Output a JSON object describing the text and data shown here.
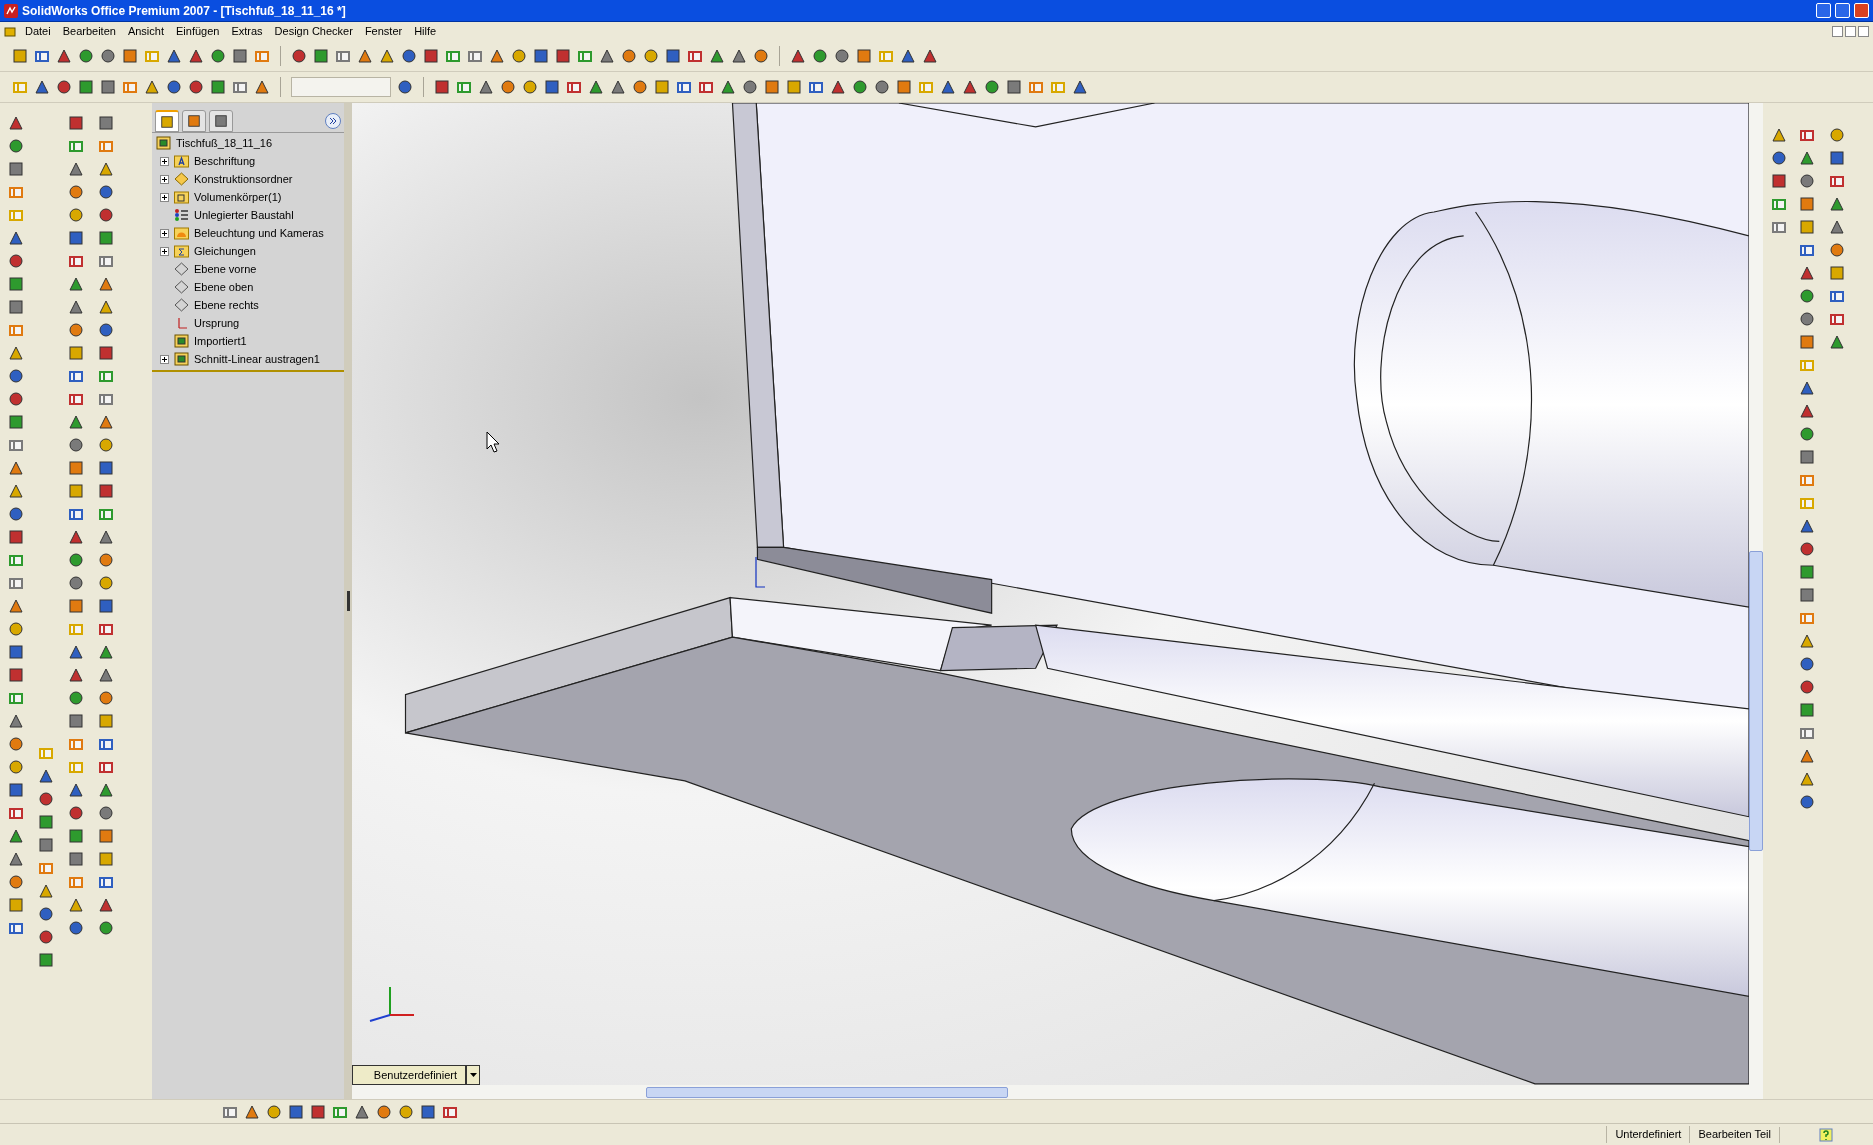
{
  "window": {
    "title": "SolidWorks Office Premium 2007 - [Tischfuß_18_11_16 *]"
  },
  "menu": [
    {
      "label": "Datei"
    },
    {
      "label": "Bearbeiten"
    },
    {
      "label": "Ansicht"
    },
    {
      "label": "Einfügen"
    },
    {
      "label": "Extras"
    },
    {
      "label": "Design Checker"
    },
    {
      "label": "Fenster"
    },
    {
      "label": "Hilfe"
    }
  ],
  "panel_tabs": [
    {
      "selected": true
    },
    {
      "selected": false
    },
    {
      "selected": false
    }
  ],
  "tree": {
    "root": "Tischfuß_18_11_16",
    "items": [
      {
        "label": "Beschriftung",
        "kind": "annotations",
        "expander": true
      },
      {
        "label": "Konstruktionsordner",
        "kind": "design",
        "expander": true
      },
      {
        "label": "Volumenkörper(1)",
        "kind": "bodies",
        "expander": true
      },
      {
        "label": "Unlegierter Baustahl",
        "kind": "material",
        "expander": false
      },
      {
        "label": "Beleuchtung und Kameras",
        "kind": "lights",
        "expander": true
      },
      {
        "label": "Gleichungen",
        "kind": "equations",
        "expander": true
      },
      {
        "label": "Ebene vorne",
        "kind": "plane",
        "expander": false
      },
      {
        "label": "Ebene oben",
        "kind": "plane",
        "expander": false
      },
      {
        "label": "Ebene rechts",
        "kind": "plane",
        "expander": false
      },
      {
        "label": "Ursprung",
        "kind": "origin",
        "expander": false
      },
      {
        "label": "Importiert1",
        "kind": "feature",
        "expander": false
      },
      {
        "label": "Schnitt-Linear austragen1",
        "kind": "feature",
        "expander": true
      }
    ]
  },
  "viewport": {
    "view_selector": "Benutzerdefiniert"
  },
  "status_bar": [
    "Unterdefiniert",
    "Bearbeiten Teil"
  ]
}
